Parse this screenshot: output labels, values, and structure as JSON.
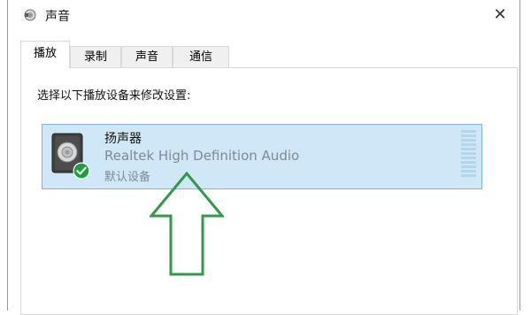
{
  "window": {
    "title": "声音",
    "close_glyph": "✕",
    "app_icon": "speaker-settings-icon"
  },
  "tabs": [
    {
      "label": "播放",
      "active": true
    },
    {
      "label": "录制",
      "active": false
    },
    {
      "label": "声音",
      "active": false
    },
    {
      "label": "通信",
      "active": false
    }
  ],
  "panel": {
    "instruction": "选择以下播放设备来修改设置:"
  },
  "device": {
    "name": "扬声器",
    "description": "Realtek High Definition Audio",
    "status": "默认设备",
    "icon": "speaker-icon",
    "badge_icon": "check-badge-icon",
    "selected": true
  },
  "colors": {
    "selection_bg": "#cfe7f6",
    "selection_border": "#7fb5dc",
    "badge_green": "#1e9e3a",
    "arrow_green": "#2f9a48"
  }
}
